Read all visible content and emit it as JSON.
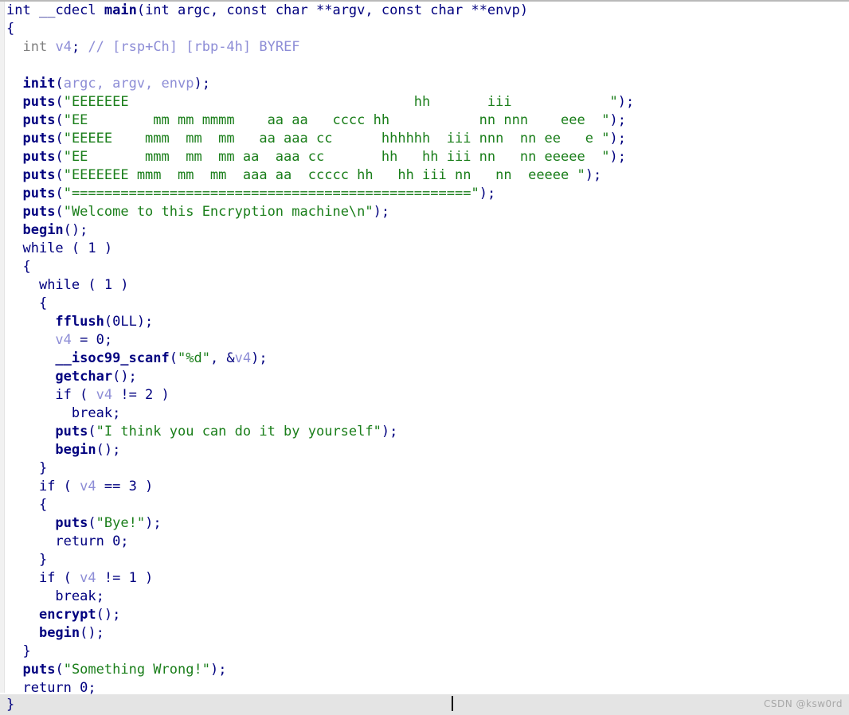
{
  "app": {
    "kind": "ida-hexrays-pseudocode",
    "watermark": "CSDN @ksw0rd"
  },
  "colors": {
    "background": "#ffffff",
    "keyword": "#00007f",
    "function": "#00007f",
    "variable": "#8d8dd6",
    "type": "#808080",
    "string": "#1a7e1a",
    "comment": "#8d8dd6",
    "current_line": "#e4e4e4",
    "gutter": "#f1f1f1",
    "watermark": "#a8a8a8"
  },
  "code": {
    "signature": {
      "ret_type": "int",
      "calling_convention": "__cdecl",
      "name": "main",
      "params": "(int argc, const char **argv, const char **envp)"
    },
    "declaration": {
      "type": "int",
      "var": "v4",
      "comment": "// [rsp+Ch] [rbp-4h] BYREF"
    },
    "init_call": {
      "fn": "init",
      "args": "argc, argv, envp"
    },
    "banner_lines": [
      "EEEEEEE                                   hh       iii            ",
      "EE        mm mm mmmm    aa aa   cccc hh           nn nnn    eee  ",
      "EEEEE    mmm  mm  mm   aa aaa cc      hhhhhh  iii nnn  nn ee   e ",
      "EE       mmm  mm  mm aa  aaa cc       hh   hh iii nn   nn eeeee  ",
      "EEEEEEE mmm  mm  mm  aaa aa  ccccc hh   hh iii nn   nn  eeeee "
    ],
    "divider_line": "=================================================",
    "welcome_line": "Welcome to this Encryption machine\\n",
    "strings": {
      "think": "I think you can do it by yourself",
      "bye": "Bye!",
      "wrong": "Something Wrong!"
    },
    "calls": {
      "begin": "begin",
      "fflush": "fflush",
      "fflush_arg": "0LL",
      "scanf": "__isoc99_scanf",
      "scanf_fmt": "%d",
      "scanf_arg": "&v4",
      "getchar": "getchar",
      "puts": "puts",
      "encrypt": "encrypt"
    },
    "conditions": {
      "while_1": "while ( 1 )",
      "if_ne_2": "if ( v4 != 2 )",
      "if_eq_3": "if ( v4 == 3 )",
      "if_ne_1": "if ( v4 != 1 )"
    },
    "statements": {
      "assign_v4_0": "v4 = 0;",
      "break": "break;",
      "return0": "return 0;"
    },
    "lines": [
      {
        "id": "line-signature",
        "indent": 0
      },
      {
        "id": "line-open-brace",
        "indent": 0
      },
      {
        "id": "line-decl",
        "indent": 1
      },
      {
        "id": "line-blank-1",
        "indent": 0
      },
      {
        "id": "line-init",
        "indent": 1
      },
      {
        "id": "line-banner-0",
        "indent": 1
      },
      {
        "id": "line-banner-1",
        "indent": 1
      },
      {
        "id": "line-banner-2",
        "indent": 1
      },
      {
        "id": "line-banner-3",
        "indent": 1
      },
      {
        "id": "line-banner-4",
        "indent": 1
      },
      {
        "id": "line-divider",
        "indent": 1
      },
      {
        "id": "line-welcome",
        "indent": 1
      },
      {
        "id": "line-begin-1",
        "indent": 1
      },
      {
        "id": "line-while-outer",
        "indent": 1
      },
      {
        "id": "line-brace-2",
        "indent": 1
      },
      {
        "id": "line-while-inner",
        "indent": 2
      },
      {
        "id": "line-brace-3",
        "indent": 2
      },
      {
        "id": "line-fflush",
        "indent": 3
      },
      {
        "id": "line-assign",
        "indent": 3
      },
      {
        "id": "line-scanf",
        "indent": 3
      },
      {
        "id": "line-getchar",
        "indent": 3
      },
      {
        "id": "line-if-ne2",
        "indent": 3
      },
      {
        "id": "line-break-1",
        "indent": 4
      },
      {
        "id": "line-puts-think",
        "indent": 3
      },
      {
        "id": "line-begin-2",
        "indent": 3
      },
      {
        "id": "line-close-3",
        "indent": 2
      },
      {
        "id": "line-if-eq3",
        "indent": 2
      },
      {
        "id": "line-brace-4",
        "indent": 2
      },
      {
        "id": "line-puts-bye",
        "indent": 3
      },
      {
        "id": "line-return-1",
        "indent": 3
      },
      {
        "id": "line-close-4",
        "indent": 2
      },
      {
        "id": "line-if-ne1",
        "indent": 2
      },
      {
        "id": "line-break-2",
        "indent": 3
      },
      {
        "id": "line-encrypt",
        "indent": 2
      },
      {
        "id": "line-begin-3",
        "indent": 2
      },
      {
        "id": "line-close-2",
        "indent": 1
      },
      {
        "id": "line-puts-wrong",
        "indent": 1
      },
      {
        "id": "line-return-2",
        "indent": 1
      },
      {
        "id": "line-close-1",
        "indent": 0
      }
    ]
  }
}
